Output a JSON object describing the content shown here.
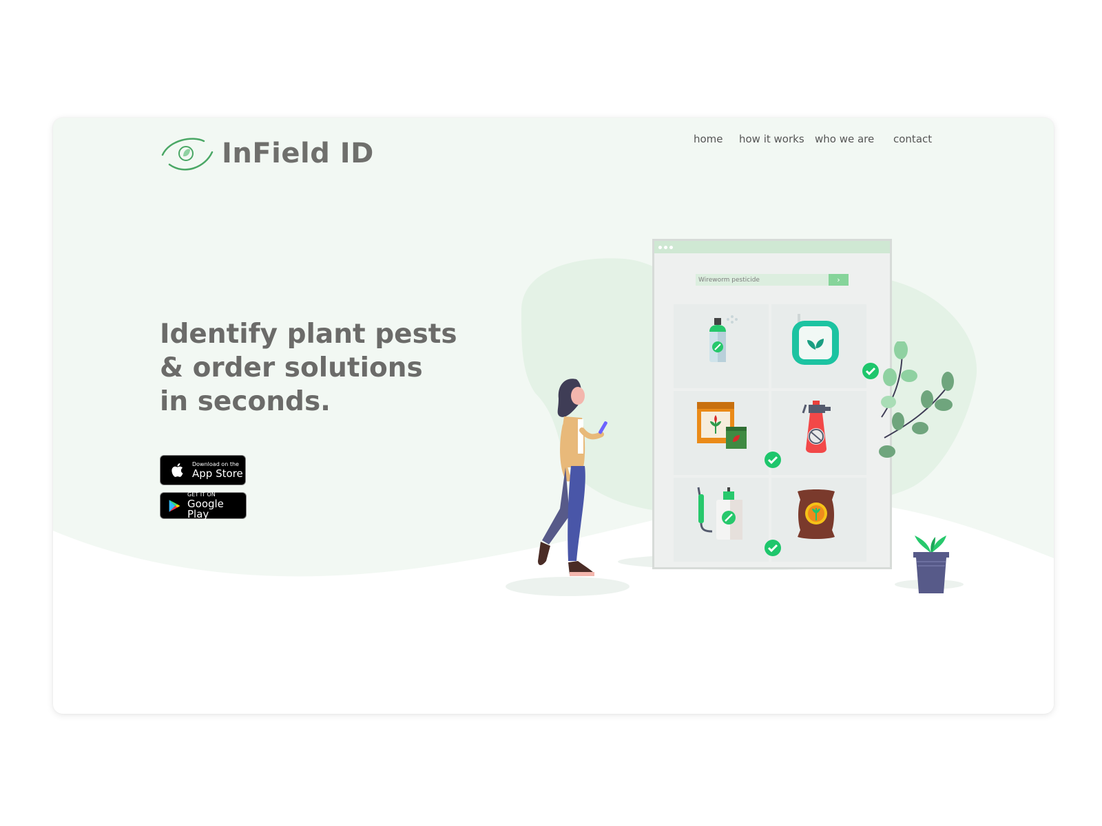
{
  "brand": {
    "name": "InField ID",
    "color": "#6f6f6c",
    "accent": "#3a9a5b"
  },
  "nav": {
    "items": [
      {
        "label": "home"
      },
      {
        "label": "how it works"
      },
      {
        "label": "who we are"
      },
      {
        "label": "contact"
      }
    ]
  },
  "hero": {
    "lines": [
      "Identify plant pests",
      "& order solutions",
      "in seconds."
    ]
  },
  "stores": {
    "apple": {
      "line1": "Download on the",
      "line2": "App Store",
      "icon": "apple-icon"
    },
    "google": {
      "line1": "GET IT ON",
      "line2": "Google Play",
      "icon": "google-play-icon"
    }
  },
  "mockup": {
    "search_value": "Wireworm pesticide",
    "search_button_icon": "chevron-right-icon",
    "products": [
      {
        "icon": "spray-can-icon",
        "selected": false
      },
      {
        "icon": "leaf-container-icon",
        "selected": true
      },
      {
        "icon": "plant-box-icon",
        "selected": true
      },
      {
        "icon": "pump-sprayer-icon",
        "selected": false
      },
      {
        "icon": "sprayer-bottle-icon",
        "selected": true
      },
      {
        "icon": "seed-bag-icon",
        "selected": false
      }
    ]
  },
  "colors": {
    "page_bg": "#ffffff",
    "card_bg": "#f2f8f3",
    "check_green": "#1ec66c",
    "mockup_bar": "#cfe8d3"
  }
}
